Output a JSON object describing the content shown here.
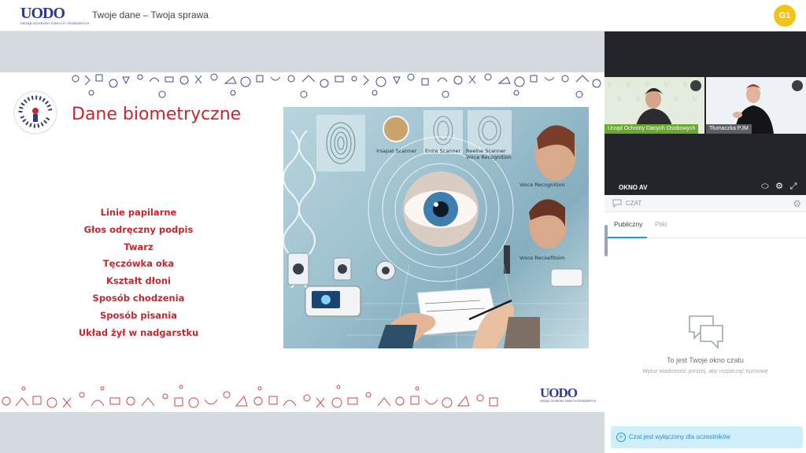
{
  "header": {
    "logo_text": "UODO",
    "logo_subtitle": "URZĄD OCHRONY DANYCH OSOBOWYCH",
    "title": "Twoje dane – Twoja sprawa",
    "avatar_initials": "G1"
  },
  "slide": {
    "badge_text": "TWOJE DANE TWOJA SPRAWA",
    "title": "Dane biometryczne",
    "items": [
      "Linie papilarne",
      "Głos odręczny podpis",
      "Twarz",
      "Tęczówka oka",
      "Kształt dłoni",
      "Sposób chodzenia",
      "Sposób pisania",
      "Układ żył w nadgarstku"
    ],
    "image_labels": {
      "label1": "Irsapat Scanner",
      "label2": "Enire Scanner",
      "label3": "Reelne Scanner",
      "label4": "Voice Recognition",
      "label5": "Voice Recognition",
      "label6": "Voice Recoefitoim"
    },
    "footer_logo_text": "UODO",
    "footer_logo_subtitle": "URZĄD OCHRONY DANYCH OSOBOWYCH"
  },
  "av_panel": {
    "title": "OKNO AV",
    "videos": [
      {
        "label": "Urząd Ochrony Danych Osobowych"
      },
      {
        "label": "Tłumaczka PJM"
      }
    ]
  },
  "chat": {
    "header_label": "CZAT",
    "tabs": [
      {
        "label": "Publiczny",
        "active": true
      },
      {
        "label": "Pliki",
        "active": false
      }
    ],
    "empty_title": "To jest Twoje okno czatu",
    "empty_subtitle": "Wpisz wiadomość poniżej, aby rozpocząć rozmowę",
    "notice": "Czat jest wyłączony dla uczestników"
  },
  "colors": {
    "brand_red": "#c8262f",
    "brand_blue": "#2e3b8c",
    "avatar_yellow": "#f3c31a",
    "tab_accent": "#2196f3",
    "notice_bg": "#cfeefb"
  }
}
